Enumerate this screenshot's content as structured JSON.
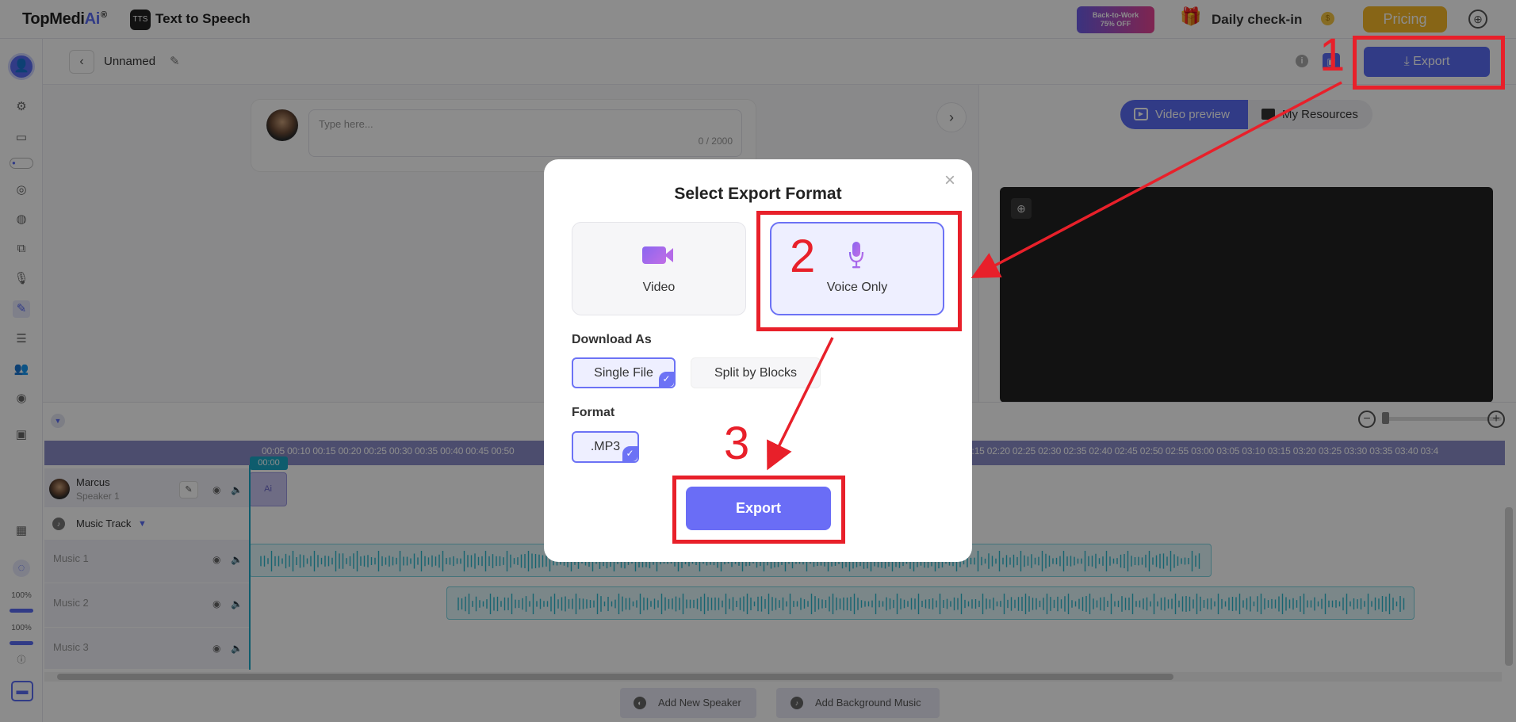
{
  "topbar": {
    "logo": "TopMedi",
    "logo_ai": "Ai",
    "logo_reg": "®",
    "app_name": "Text to Speech",
    "promo_line1": "Back-to-Work",
    "promo_line2": "75% OFF",
    "checkin": "Daily check-in",
    "pricing": "Pricing",
    "icons": [
      "gift-icon",
      "coin-icon",
      "globe-icon"
    ]
  },
  "sidebar": {
    "zoom1": "100%",
    "zoom2": "100%",
    "icons": [
      "user-avatar",
      "ai-icon",
      "folder-icon",
      "toggle-icon",
      "voice-clone-icon",
      "audio-icon",
      "copy-icon",
      "mic-icon",
      "pen-icon",
      "doc-icon",
      "users-icon",
      "globe-icon",
      "briefcase-icon",
      "grid-icon",
      "chat-icon",
      "info-icon",
      "card-icon"
    ]
  },
  "project": {
    "name": "Unnamed",
    "export_label": "Export"
  },
  "editor": {
    "placeholder": "Type here...",
    "char_count": "0 / 2000"
  },
  "preview": {
    "tab_video": "Video preview",
    "tab_resources": "My Resources"
  },
  "timeline": {
    "ticks": "00:05 00:10 00:15 00:20 00:25 00:30 00:35 00:40 00:45 00:50",
    "ticks_right": "0 02:15 02:20 02:25 02:30 02:35 02:40 02:45 02:50 02:55 03:00 03:05 03:10 03:15 03:20 03:25 03:30 03:35 03:40 03:4",
    "playhead_time": "00:00",
    "speaker_name": "Marcus",
    "speaker_role": "Speaker 1",
    "clip_text": "Ai",
    "music_track": "Music Track",
    "music_rows": [
      "Music 1",
      "Music 2",
      "Music 3"
    ],
    "add_speaker": "Add New Speaker",
    "add_music": "Add Background Music"
  },
  "modal": {
    "title": "Select Export Format",
    "option_video": "Video",
    "option_voice": "Voice Only",
    "selected_option": "Voice Only",
    "download_as_label": "Download As",
    "download_single": "Single File",
    "download_split": "Split by Blocks",
    "selected_download": "Single File",
    "format_label": "Format",
    "format_value": ".MP3",
    "export_button": "Export"
  },
  "annotations": {
    "step1": "1",
    "step2": "2",
    "step3": "3",
    "color": "#e8202a"
  },
  "colors": {
    "accent": "#5a6cf5",
    "pricing": "#f6b928",
    "teal": "#1aa8c6"
  }
}
